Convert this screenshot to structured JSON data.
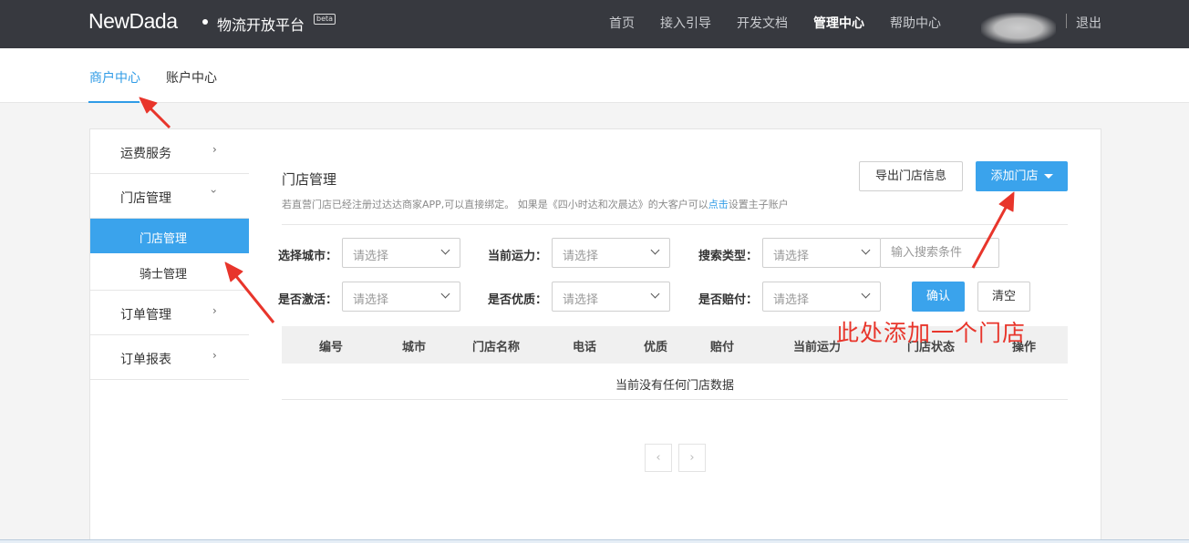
{
  "header": {
    "logo": "NewDada",
    "subtitle": "物流开放平台",
    "badge": "beta",
    "nav": [
      "首页",
      "接入引导",
      "开发文档",
      "管理中心",
      "帮助中心"
    ],
    "active_nav": "管理中心",
    "logout": "退出"
  },
  "tabs": [
    {
      "label": "商户中心",
      "active": true
    },
    {
      "label": "账户中心",
      "active": false
    }
  ],
  "sidebar": {
    "items": [
      {
        "label": "运费服务",
        "chevron": "chevron-right-icon"
      },
      {
        "label": "门店管理",
        "chevron": "chevron-down-icon"
      },
      {
        "label": "订单管理",
        "chevron": "chevron-right-icon"
      },
      {
        "label": "订单报表",
        "chevron": "chevron-right-icon"
      }
    ],
    "sub_items": [
      {
        "label": "门店管理",
        "active": true
      },
      {
        "label": "骑士管理",
        "active": false
      }
    ]
  },
  "panel": {
    "title": "门店管理",
    "hint_before": "若直营门店已经注册过达达商家APP,可以直接绑定。 如果是《四小时达和次晨达》的大客户可以",
    "hint_link": "点击",
    "hint_after": "设置主子账户",
    "export_button": "导出门店信息",
    "add_button": "添加门店"
  },
  "filters": {
    "city_label": "选择城市：",
    "capacity_label": "当前运力：",
    "search_type_label": "搜索类型：",
    "activated_label": "是否激活：",
    "quality_label": "是否优质：",
    "compensation_label": "是否赔付：",
    "select_placeholder": "请选择",
    "search_placeholder": "输入搜索条件",
    "confirm_button": "确认",
    "clear_button": "清空"
  },
  "table": {
    "columns": [
      "编号",
      "城市",
      "门店名称",
      "电话",
      "优质",
      "赔付",
      "当前运力",
      "门店状态",
      "操作"
    ],
    "empty_text": "当前没有任何门店数据"
  },
  "pagination": {
    "prev": "‹",
    "next": "›"
  },
  "annotation": "此处添加一个门店",
  "colors": {
    "accent": "#3aa3ec",
    "topbar": "#37393f",
    "annotation": "#e8352b"
  }
}
